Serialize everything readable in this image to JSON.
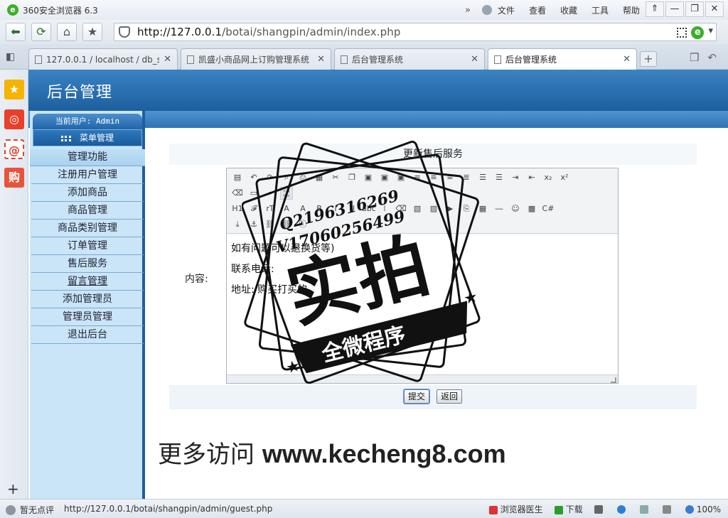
{
  "browser": {
    "logo": "e",
    "title": "360安全浏览器 6.3",
    "menu": [
      "文件",
      "查看",
      "收藏",
      "工具",
      "帮助"
    ],
    "window_buttons": [
      "⇑",
      "—",
      "❐",
      "✕"
    ],
    "url_host": "http://127.0.0.1",
    "url_path": "/botai/shangpin/admin/index.php",
    "tabs": [
      {
        "label": "127.0.0.1 / localhost / db_sh"
      },
      {
        "label": "凯盛小商品网上订购管理系统"
      },
      {
        "label": "后台管理系统"
      },
      {
        "label": "后台管理系统"
      }
    ],
    "status_comment": "暂无点评",
    "status_url": "http://127.0.0.1/botai/shangpin/admin/guest.php",
    "status_doctor": "浏览器医生",
    "status_download": "下载",
    "zoom": "100%"
  },
  "page": {
    "admin_title": "后台管理",
    "current_user": "当前用户: Admin",
    "menu_header": "菜单管理",
    "menu_section": "管理功能",
    "menu_items": [
      "注册用户管理",
      "添加商品",
      "商品管理",
      "商品类别管理",
      "订单管理",
      "售后服务",
      "留言管理",
      "添加管理员",
      "管理员管理",
      "退出后台"
    ],
    "form_title": "更新售后服务",
    "content_label": "内容:",
    "editor_lines": [
      "如有问题可以退换货等)",
      "联系电话:",
      "地址: 购买打买的"
    ],
    "submit": "提交",
    "back": "返回",
    "promo_cn": "更多访问",
    "promo_url": "www.kecheng8.com"
  },
  "watermark": {
    "qq": "Q2196316269",
    "vx": "V17060256499",
    "big": "实拍",
    "banner": "全微程序"
  },
  "colors": {
    "header_blue": "#1c5f9f",
    "sidebar_bg": "#c9e5f7",
    "green": "#3fae29"
  }
}
